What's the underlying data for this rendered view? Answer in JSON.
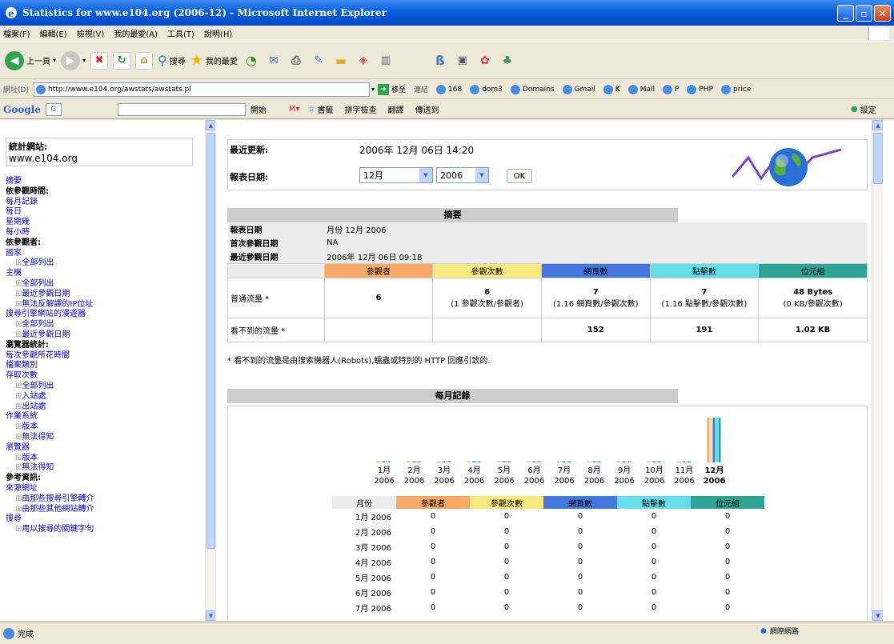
{
  "window": {
    "title": "Statistics for www.e104.org (2006-12) - Microsoft Internet Explorer"
  },
  "menubar": [
    "檔案(F)",
    "編輯(E)",
    "檢視(V)",
    "我的最愛(A)",
    "工具(T)",
    "說明(H)"
  ],
  "toolbar": {
    "back": "上一頁",
    "search": "搜尋",
    "favorites": "我的最愛"
  },
  "address": {
    "label": "網址(D)",
    "url": "http://www.e104.org/awstats/awstats.pl",
    "go": "移至",
    "links_label": "連結",
    "links": [
      "168",
      "dom3",
      "Domains",
      "Gmail",
      "K",
      "Mail",
      "P",
      "PHP",
      "price"
    ]
  },
  "googlebar": {
    "logo": "Google",
    "search_btn": "G",
    "items": [
      "開始",
      "書籤",
      "拼字檢查",
      "翻譯",
      "傳送到"
    ],
    "settings": "設定"
  },
  "left": {
    "site_label": "統計網站:",
    "site": "www.e104.org",
    "nav": [
      {
        "t": "摘要",
        "k": "link"
      },
      {
        "t": "依參觀時間:",
        "k": "hd"
      },
      {
        "t": "每月記錄",
        "k": "link"
      },
      {
        "t": "每日",
        "k": "link"
      },
      {
        "t": "星期幾",
        "k": "link"
      },
      {
        "t": "每小時",
        "k": "link"
      },
      {
        "t": "依參觀者:",
        "k": "hd"
      },
      {
        "t": "國家",
        "k": "link"
      },
      {
        "t": "全部列出",
        "k": "sub"
      },
      {
        "t": "主機",
        "k": "link"
      },
      {
        "t": "全部列出",
        "k": "sub"
      },
      {
        "t": "最近參觀日期",
        "k": "sub"
      },
      {
        "t": "無法反解譯的IP位址",
        "k": "sub"
      },
      {
        "t": "搜尋引擎網站的漫遊器",
        "k": "link"
      },
      {
        "t": "全部列出",
        "k": "sub"
      },
      {
        "t": "最近參觀日期",
        "k": "sub"
      },
      {
        "t": "瀏覽器統計:",
        "k": "hd"
      },
      {
        "t": "每次參觀所花時間",
        "k": "link"
      },
      {
        "t": "檔案類別",
        "k": "link"
      },
      {
        "t": "存取次數",
        "k": "link"
      },
      {
        "t": "全部列出",
        "k": "sub"
      },
      {
        "t": "入站處",
        "k": "sub"
      },
      {
        "t": "出站處",
        "k": "sub"
      },
      {
        "t": "作業系統",
        "k": "link"
      },
      {
        "t": "版本",
        "k": "sub"
      },
      {
        "t": "無法得知",
        "k": "sub"
      },
      {
        "t": "瀏覽器",
        "k": "link"
      },
      {
        "t": "版本",
        "k": "sub"
      },
      {
        "t": "無法得知",
        "k": "sub"
      },
      {
        "t": "參考資訊:",
        "k": "hd"
      },
      {
        "t": "來源網址",
        "k": "link"
      },
      {
        "t": "由那些搜尋引擎轉介",
        "k": "sub"
      },
      {
        "t": "由那些其他網站轉介",
        "k": "sub"
      },
      {
        "t": "搜尋",
        "k": "link"
      },
      {
        "t": "用以搜尋的關鍵字句",
        "k": "sub"
      }
    ]
  },
  "header": {
    "last_update_label": "最近更新:",
    "last_update": "2006年 12月 06日 14:20",
    "period_label": "報表日期:",
    "month": "12月",
    "year": "2006",
    "ok": "OK"
  },
  "summary": {
    "title": "摘要",
    "period_label": "報表日期",
    "period_value": "月份 12月 2006",
    "first_label": "首次參觀日期",
    "first_value": "NA",
    "last_label": "最近參觀日期",
    "last_value": "2006年 12月 06日 09:18",
    "cols": [
      "參觀者",
      "參觀次數",
      "網頁數",
      "點擊數",
      "位元組"
    ],
    "viewed_label": "普通流量 *",
    "viewed": [
      [
        "6",
        ""
      ],
      [
        "6",
        "(1 參觀次數/參觀者)"
      ],
      [
        "7",
        "(1.16 網頁數/參觀次數)"
      ],
      [
        "7",
        "(1.16 點擊數/參觀次數)"
      ],
      [
        "48 Bytes",
        "(0 KB/參觀次數)"
      ]
    ],
    "notviewed_label": "看不到的流量 *",
    "notviewed": [
      "",
      "",
      "152",
      "191",
      "1.02 KB"
    ],
    "footnote": "* 看不到的流量是由搜索機器人(Robots),蠕蟲或特別的 HTTP 回應引致的."
  },
  "monthly": {
    "title": "每月記錄",
    "months": [
      "1月",
      "2月",
      "3月",
      "4月",
      "5月",
      "6月",
      "7月",
      "8月",
      "9月",
      "10月",
      "11月",
      "12月"
    ],
    "year": "2006",
    "table_cols": [
      "月份",
      "參觀者",
      "參觀次數",
      "網頁數",
      "點擊數",
      "位元組"
    ],
    "rows": [
      [
        "1月 2006",
        "0",
        "0",
        "0",
        "0",
        "0"
      ],
      [
        "2月 2006",
        "0",
        "0",
        "0",
        "0",
        "0"
      ],
      [
        "3月 2006",
        "0",
        "0",
        "0",
        "0",
        "0"
      ],
      [
        "4月 2006",
        "0",
        "0",
        "0",
        "0",
        "0"
      ],
      [
        "5月 2006",
        "0",
        "0",
        "0",
        "0",
        "0"
      ],
      [
        "6月 2006",
        "0",
        "0",
        "0",
        "0",
        "0"
      ],
      [
        "7月 2006",
        "0",
        "0",
        "0",
        "0",
        "0"
      ]
    ]
  },
  "chart_data": {
    "type": "bar",
    "categories": [
      "1月 2006",
      "2月 2006",
      "3月 2006",
      "4月 2006",
      "5月 2006",
      "6月 2006",
      "7月 2006",
      "8月 2006",
      "9月 2006",
      "10月 2006",
      "11月 2006",
      "12月 2006"
    ],
    "series": [
      {
        "name": "參觀者",
        "color": "#f9a966",
        "values": [
          0,
          0,
          0,
          0,
          0,
          0,
          0,
          0,
          0,
          0,
          0,
          6
        ]
      },
      {
        "name": "參觀次數",
        "color": "#f8e880",
        "values": [
          0,
          0,
          0,
          0,
          0,
          0,
          0,
          0,
          0,
          0,
          0,
          6
        ]
      },
      {
        "name": "網頁數",
        "color": "#4477dd",
        "values": [
          0,
          0,
          0,
          0,
          0,
          0,
          0,
          0,
          0,
          0,
          0,
          7
        ]
      },
      {
        "name": "點擊數",
        "color": "#66dde9",
        "values": [
          0,
          0,
          0,
          0,
          0,
          0,
          0,
          0,
          0,
          0,
          0,
          7
        ]
      },
      {
        "name": "位元組",
        "color": "#2ea495",
        "values": [
          0,
          0,
          0,
          0,
          0,
          0,
          0,
          0,
          0,
          0,
          0,
          48
        ]
      }
    ]
  },
  "status": {
    "text": "完成",
    "zone": "網際網路"
  }
}
